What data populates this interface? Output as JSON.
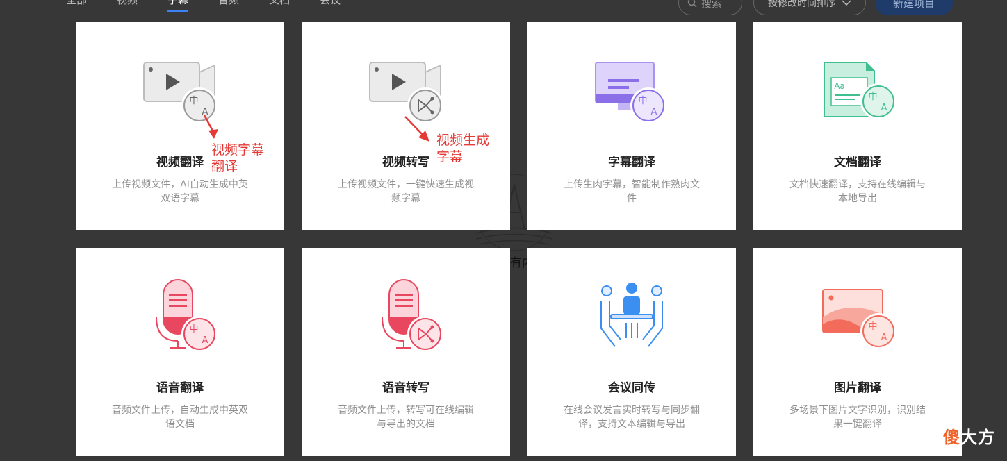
{
  "tabs": [
    {
      "label": "全部"
    },
    {
      "label": "视频"
    },
    {
      "label": "字幕"
    },
    {
      "label": "音频"
    },
    {
      "label": "文档"
    },
    {
      "label": "会议"
    }
  ],
  "active_tab": "字幕",
  "search": {
    "placeholder": "搜索"
  },
  "sort": {
    "selected": "按修改时间排序"
  },
  "new_project_label": "新建项目",
  "watermark_text": "有内",
  "cards": [
    {
      "title": "视频翻译",
      "desc": "上传视频文件，AI自动生成中英双语字幕",
      "icon": "video-translate-icon"
    },
    {
      "title": "视频转写",
      "desc": "上传视频文件，一键快速生成视频字幕",
      "icon": "video-transcribe-icon"
    },
    {
      "title": "字幕翻译",
      "desc": "上传生肉字幕，智能制作熟肉文件",
      "icon": "subtitle-translate-icon"
    },
    {
      "title": "文档翻译",
      "desc": "文档快速翻译，支持在线编辑与本地导出",
      "icon": "document-translate-icon"
    },
    {
      "title": "语音翻译",
      "desc": "音频文件上传，自动生成中英双语文档",
      "icon": "audio-translate-icon"
    },
    {
      "title": "语音转写",
      "desc": "音频文件上传，转写可在线编辑与导出的文档",
      "icon": "audio-transcribe-icon"
    },
    {
      "title": "会议同传",
      "desc": "在线会议发言实时转写与同步翻译，支持文本编辑与导出",
      "icon": "meeting-interpret-icon"
    },
    {
      "title": "图片翻译",
      "desc": "多场景下图片文字识别，识别结果一键翻译",
      "icon": "image-translate-icon"
    }
  ],
  "annotations": {
    "video_translate": [
      "视频字幕",
      "翻译"
    ],
    "video_transcribe": [
      "视频生成",
      "字幕"
    ]
  },
  "logo": {
    "left": "傻",
    "right": "大方"
  },
  "colors": {
    "background": "#373737",
    "annotation": "#e53935",
    "purple": "#8b6fe8",
    "green": "#3fbf8f",
    "red": "#e8475f",
    "blue": "#3b8ff0",
    "orange": "#f26b5b"
  }
}
